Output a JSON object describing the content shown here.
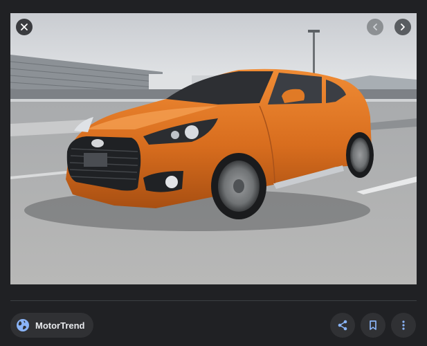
{
  "viewer": {
    "source": {
      "name": "MotorTrend",
      "icon": "globe-icon"
    },
    "controls": {
      "close_icon": "close-icon",
      "prev_icon": "chevron-left-icon",
      "next_icon": "chevron-right-icon"
    },
    "actions": {
      "share_icon": "share-icon",
      "save_icon": "bookmark-icon",
      "more_icon": "more-vert-icon"
    },
    "colors": {
      "background": "#202124",
      "chip": "#303134",
      "accent": "#8ab4f8",
      "icon": "#e8eaed",
      "car_paint": "#e07a26"
    }
  }
}
